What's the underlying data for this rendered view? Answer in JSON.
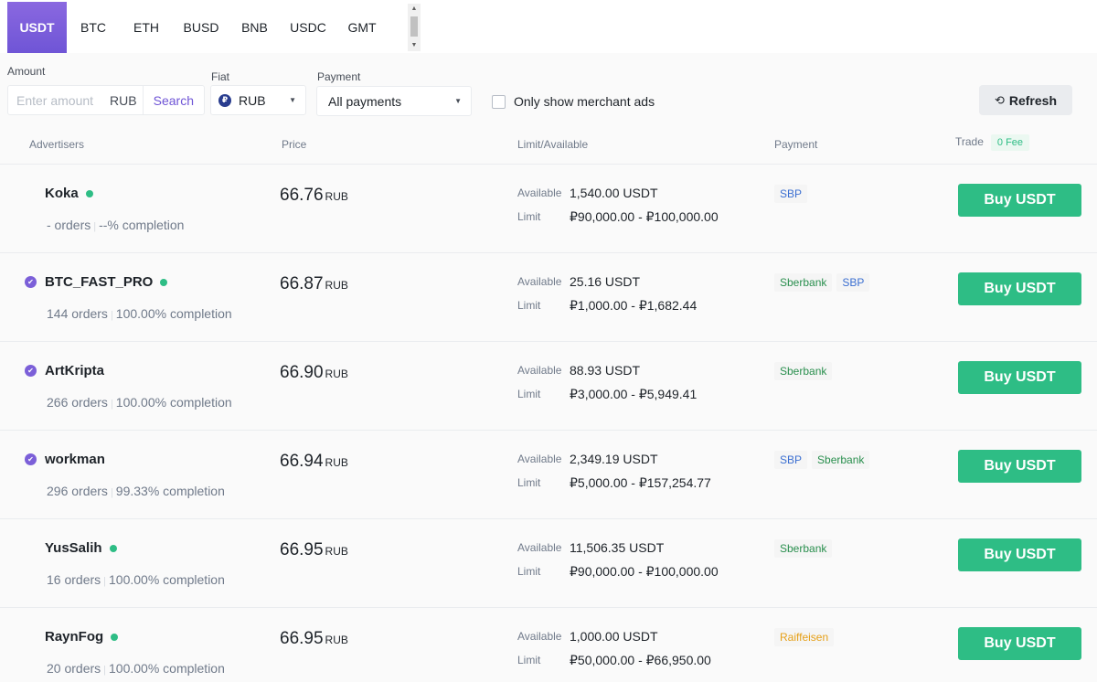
{
  "tabs": [
    "USDT",
    "BTC",
    "ETH",
    "BUSD",
    "BNB",
    "USDC",
    "GMT"
  ],
  "filters": {
    "amount_label": "Amount",
    "amount_placeholder": "Enter amount",
    "amount_unit": "RUB",
    "search_label": "Search",
    "fiat_label": "Fiat",
    "fiat_value": "RUB",
    "fiat_icon_letter": "₽",
    "payment_label": "Payment",
    "payment_value": "All payments",
    "merchant_label": "Only show merchant ads",
    "refresh_label": "Refresh"
  },
  "headers": {
    "advertisers": "Advertisers",
    "price": "Price",
    "limit": "Limit/Available",
    "payment": "Payment",
    "trade": "Trade",
    "fee": "0 Fee"
  },
  "colors": {
    "accent": "#6f55d6",
    "buy": "#2ebd85",
    "online": "#2ebd85"
  },
  "rows": [
    {
      "name": "Koka",
      "verified": false,
      "orders": "- orders",
      "completion": "--% completion",
      "price": "66.76",
      "currency": "RUB",
      "available_label": "Available",
      "available": "1,540.00 USDT",
      "limit_label": "Limit",
      "limit": "₽90,000.00 - ₽100,000.00",
      "payments": [
        {
          "name": "SBP",
          "color": "blue"
        }
      ],
      "button": "Buy USDT"
    },
    {
      "name": "BTC_FAST_PRO",
      "verified": true,
      "orders": "144 orders",
      "completion": "100.00% completion",
      "price": "66.87",
      "currency": "RUB",
      "available_label": "Available",
      "available": "25.16 USDT",
      "limit_label": "Limit",
      "limit": "₽1,000.00 - ₽1,682.44",
      "payments": [
        {
          "name": "Sberbank",
          "color": "green"
        },
        {
          "name": "SBP",
          "color": "blue"
        }
      ],
      "button": "Buy USDT"
    },
    {
      "name": "ArtKripta",
      "verified": true,
      "orders": "266 orders",
      "completion": "100.00% completion",
      "price": "66.90",
      "currency": "RUB",
      "available_label": "Available",
      "available": "88.93 USDT",
      "limit_label": "Limit",
      "limit": "₽3,000.00 - ₽5,949.41",
      "payments": [
        {
          "name": "Sberbank",
          "color": "green"
        }
      ],
      "button": "Buy USDT"
    },
    {
      "name": "workman",
      "verified": true,
      "orders": "296 orders",
      "completion": "99.33% completion",
      "price": "66.94",
      "currency": "RUB",
      "available_label": "Available",
      "available": "2,349.19 USDT",
      "limit_label": "Limit",
      "limit": "₽5,000.00 - ₽157,254.77",
      "payments": [
        {
          "name": "SBP",
          "color": "blue"
        },
        {
          "name": "Sberbank",
          "color": "green"
        }
      ],
      "button": "Buy USDT"
    },
    {
      "name": "YusSalih",
      "verified": false,
      "orders": "16 orders",
      "completion": "100.00% completion",
      "price": "66.95",
      "currency": "RUB",
      "available_label": "Available",
      "available": "11,506.35 USDT",
      "limit_label": "Limit",
      "limit": "₽90,000.00 - ₽100,000.00",
      "payments": [
        {
          "name": "Sberbank",
          "color": "green"
        }
      ],
      "button": "Buy USDT"
    },
    {
      "name": "RaynFog",
      "verified": false,
      "orders": "20 orders",
      "completion": "100.00% completion",
      "price": "66.95",
      "currency": "RUB",
      "available_label": "Available",
      "available": "1,000.00 USDT",
      "limit_label": "Limit",
      "limit": "₽50,000.00 - ₽66,950.00",
      "payments": [
        {
          "name": "Raiffeisen",
          "color": "yellow"
        }
      ],
      "button": "Buy USDT"
    }
  ]
}
